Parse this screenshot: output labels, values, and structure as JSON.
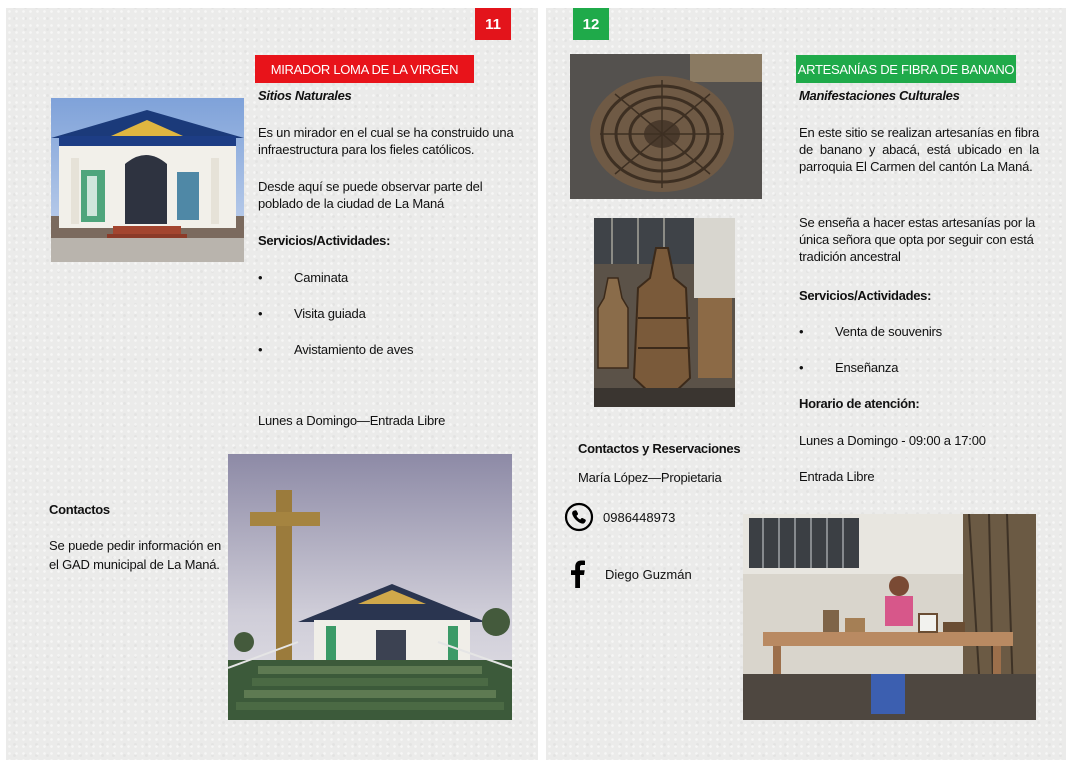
{
  "page11": {
    "number": "11",
    "number_color": "#e3141b",
    "banner": "MIRADOR LOMA DE LA VIRGEN",
    "banner_color": "#e8131a",
    "category": "Sitios Naturales",
    "paragraphs": [
      "Es un mirador en el cual se ha construido una infraestructura para los fieles católicos.",
      "Desde aquí se puede observar parte del poblado de la ciudad de La Maná"
    ],
    "services_heading": "Servicios/Actividades:",
    "services": [
      "Caminata",
      "Visita guiada",
      "Avistamiento de aves"
    ],
    "schedule": "Lunes a Domingo—Entrada Libre",
    "contacts_heading": "Contactos",
    "contacts_text": "Se puede pedir información en el GAD municipal de La Maná."
  },
  "page12": {
    "number": "12",
    "number_color": "#1faa4a",
    "banner": "ARTESANÍAS DE FIBRA DE BANANO",
    "banner_color": "#1faa4a",
    "category": "Manifestaciones Culturales",
    "paragraphs": [
      "En este sitio se realizan artesanías en fibra de banano y abacá, está ubicado en la parroquia El Carmen del cantón La Maná.",
      "Se enseña a hacer estas artesanías por la única señora que opta por seguir con está tradición ancestral"
    ],
    "services_heading": "Servicios/Actividades:",
    "services": [
      "Venta de souvenirs",
      "Enseñanza"
    ],
    "hours_heading": "Horario de atención:",
    "hours": "Lunes a Domingo - 09:00 a 17:00",
    "entry": "Entrada Libre",
    "contacts_heading": "Contactos y Reservaciones",
    "owner": "María López—Propietaria",
    "phone": "0986448973",
    "facebook": "Diego Guzmán"
  },
  "icons": {
    "phone": "phone-icon",
    "facebook": "facebook-icon"
  }
}
